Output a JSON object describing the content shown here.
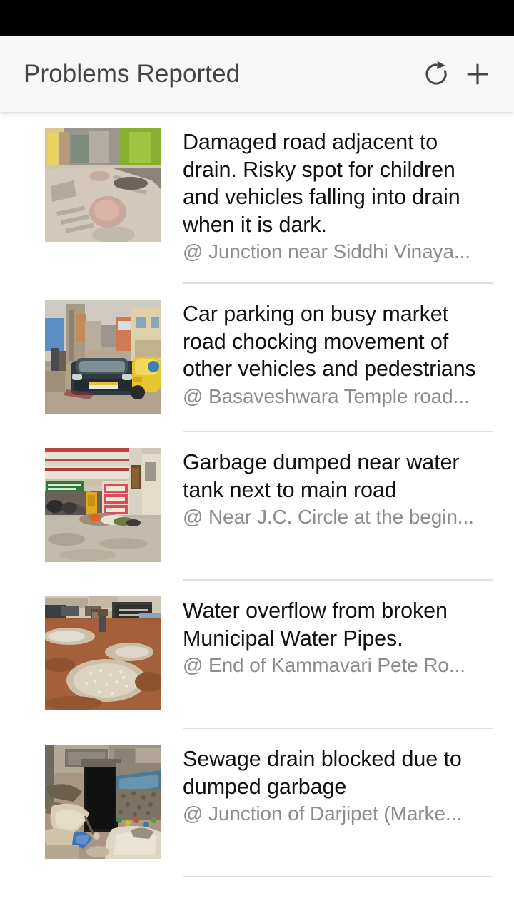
{
  "app_bar": {
    "title": "Problems Reported",
    "actions": [
      {
        "name": "refresh-icon",
        "label": "Refresh"
      },
      {
        "name": "add-icon",
        "label": "Add"
      }
    ]
  },
  "colors": {
    "status_bar": "#000000",
    "app_bar_bg": "#f7f7f7",
    "title_text": "#444444",
    "item_title_text": "#111111",
    "item_subtitle_text": "#8c8c8c",
    "divider": "#e0e0e0",
    "page_bg": "#ffffff"
  },
  "list": {
    "items": [
      {
        "title": "Damaged road adjacent to drain. Risky spot for children and vehicles falling into drain when it is dark.",
        "location": "@ Junction near Siddhi Vinaya...",
        "thumbnail": "damaged-road-photo"
      },
      {
        "title": "Car parking on busy market road chocking movement of other vehicles and pedestrians",
        "location": "@ Basaveshwara Temple road...",
        "thumbnail": "car-parking-photo"
      },
      {
        "title": "Garbage dumped near water tank next to main road",
        "location": "@ Near J.C. Circle at the begin...",
        "thumbnail": "garbage-dump-photo"
      },
      {
        "title": "Water overflow from broken Municipal Water Pipes.",
        "location": "@ End of Kammavari Pete Ro...",
        "thumbnail": "water-overflow-photo"
      },
      {
        "title": "Sewage drain blocked due to dumped garbage",
        "location": "@ Junction of Darjipet (Marke...",
        "thumbnail": "sewage-drain-photo"
      }
    ]
  }
}
